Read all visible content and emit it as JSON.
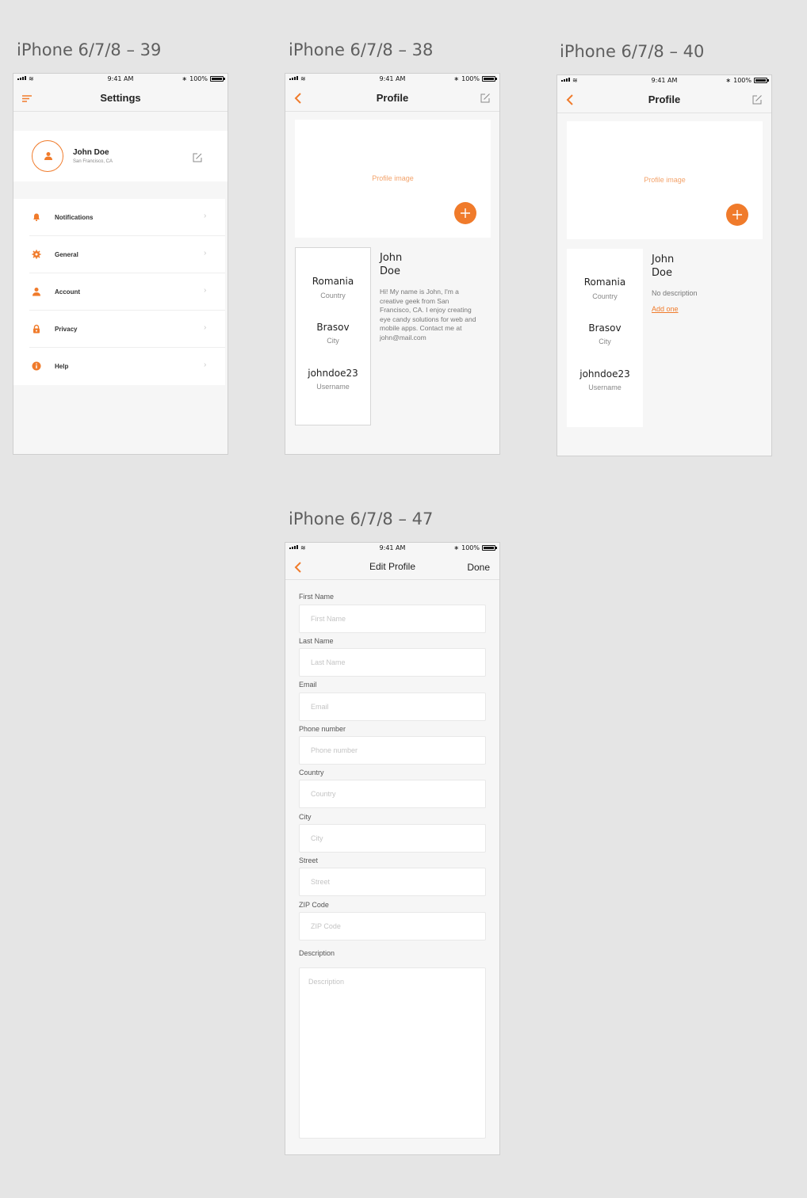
{
  "statusbar": {
    "time": "9:41 AM",
    "battery": "100%"
  },
  "artboards": {
    "settings": "iPhone 6/7/8 – 39",
    "profile": "iPhone 6/7/8 – 38",
    "profile_empty": "iPhone 6/7/8 – 40",
    "edit_profile": "iPhone 6/7/8 – 47"
  },
  "settings": {
    "title": "Settings",
    "user": {
      "name": "John Doe",
      "location": "San Francisco, CA"
    },
    "items": [
      {
        "label": "Notifications",
        "icon": "bell-icon"
      },
      {
        "label": "General",
        "icon": "gear-icon"
      },
      {
        "label": "Account",
        "icon": "user-icon"
      },
      {
        "label": "Privacy",
        "icon": "lock-icon"
      },
      {
        "label": "Help",
        "icon": "info-icon"
      }
    ],
    "chevron": "›"
  },
  "profile": {
    "title": "Profile",
    "image_placeholder": "Profile image",
    "first_name": "John",
    "last_name": "Doe",
    "description": "Hi! My name is John, I'm a creative geek from San Francisco, CA. I enjoy creating eye candy solutions for web and mobile apps. Contact me at john@mail.com",
    "fields": [
      {
        "value": "Romania",
        "label": "Country"
      },
      {
        "value": "Brasov",
        "label": "City"
      },
      {
        "value": "johndoe23",
        "label": "Username"
      }
    ]
  },
  "profile_empty": {
    "title": "Profile",
    "image_placeholder": "Profile image",
    "first_name": "John",
    "last_name": "Doe",
    "no_description": "No description",
    "add_one": "Add one",
    "fields": [
      {
        "value": "Romania",
        "label": "Country"
      },
      {
        "value": "Brasov",
        "label": "City"
      },
      {
        "value": "johndoe23",
        "label": "Username"
      }
    ]
  },
  "edit_profile": {
    "title": "Edit Profile",
    "done": "Done",
    "fields": [
      {
        "label": "First Name",
        "placeholder": "First Name"
      },
      {
        "label": "Last Name",
        "placeholder": "Last Name"
      },
      {
        "label": "Email",
        "placeholder": "Email"
      },
      {
        "label": "Phone number",
        "placeholder": "Phone number"
      },
      {
        "label": "Country",
        "placeholder": "Country"
      },
      {
        "label": "City",
        "placeholder": "City"
      },
      {
        "label": "Street",
        "placeholder": "Street"
      },
      {
        "label": "ZIP Code",
        "placeholder": "ZIP Code"
      }
    ],
    "description": {
      "label": "Description",
      "placeholder": "Description"
    }
  },
  "colors": {
    "accent": "#f07b2b",
    "background": "#e5e5e5",
    "screen": "#f6f6f6"
  }
}
